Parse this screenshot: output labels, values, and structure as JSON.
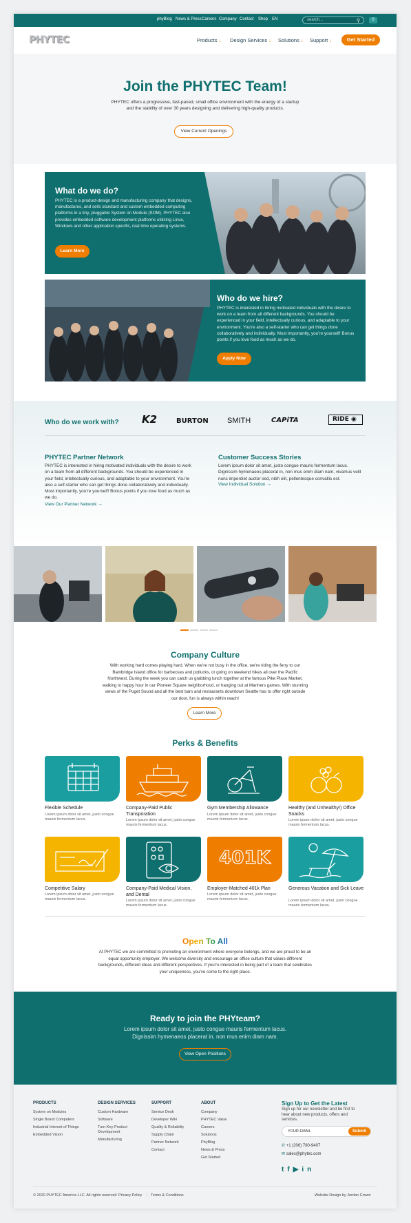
{
  "topnav": {
    "items": [
      "phyBlog",
      "News & Press",
      "Careers",
      "Company",
      "Contact",
      "Shop",
      "EN"
    ],
    "search_placeholder": "search...",
    "cart_count": "0"
  },
  "header": {
    "logo": "PHYTEC",
    "nav": [
      "Products",
      "Design Services",
      "Solutions",
      "Support"
    ],
    "cta": "Get Started"
  },
  "hero": {
    "title": "Join the PHYTEC Team!",
    "text": "PHYTEC offers a progressive, fast-paced, small office environment with the energy of a startup and the stability of over 30 years designing and delivering high-quality products.",
    "button": "View Current Openings"
  },
  "what": {
    "title": "What do we do?",
    "text": "PHYTEC is a product-design and manufacturing company that designs, manufactures, and sells standard and custom embedded computing platforms in a tiny, pluggable System on Module (SOM). PHYTEC also provides embedded software development platforms utilizing Linux, Windows and other application specific, real time operating systems.",
    "button": "Learn More"
  },
  "who": {
    "title": "Who do we hire?",
    "text": "PHYTEC is interested in hiring motivated individuals with the desire to work on a team from all different backgrounds. You should be experienced in your field, intellectually curious, and adaptable to your environment. You’re also a self-starter who can get things done collaboratively and individually. Most importantly, you’re yourself! Bonus points if you love food as much as we do.",
    "button": "Apply Now"
  },
  "work_with": {
    "title": "Who do we work with?",
    "brands": [
      "K2",
      "BURTON",
      "SMITH",
      "CAPiTA",
      "RIDE"
    ]
  },
  "partner": {
    "title": "PHYTEC Partner Network",
    "text": "PHYTEC is interested in hiring motivated individuals with the desire to work on a team from all different backgrounds. You should be experienced in your field, intellectually curious, and adaptable to your environment. You’re also a self-starter who can get things done collaboratively and individually. Most importantly, you’re yourself! Bonus points if you love food as much as we do.",
    "link": "View Our Partner Network"
  },
  "success": {
    "title": "Customer Success Stories",
    "text": "Lorem ipsum dolor sit amet, justo congue mauris fermentum lacus. Dignissim hymenaeos placerat in, non mus enim diam nam, vivamus velit nunc imperdiet auctor sed, nibh elit, pellentesque convallis est.",
    "link": "View Individual Solution"
  },
  "culture": {
    "title": "Company Culture",
    "text": "With working hard comes playing hard. When we’re not busy in the office, we’re riding the ferry to our Bainbridge Island office for barbecues and potlucks, or going on weekend hikes all over the Pacific Northwest. During the week you can catch us grabbing lunch together at the famous Pike Place Market, walking to happy hour in our Pioneer Square neighborhood, or hanging out at Mariners games. With stunning views of the Puget Sound and all the best bars and restaurants downtown Seattle has to offer right outside our door, fun is always within reach!",
    "button": "Learn More"
  },
  "perks": {
    "title": "Perks & Benefits",
    "items": [
      {
        "title": "Flexible Schedule",
        "desc": "Lorem ipsum dolor sit amet, justo congue mauris fermentum lacus.",
        "color": "#1b9ea0",
        "icon": "calendar-icon"
      },
      {
        "title": "Company-Paid Public Transporation",
        "desc": "Lorem ipsum dolor sit amet, justo congue mauris fermentum lacus.",
        "color": "#ef7d00",
        "icon": "ferry-icon"
      },
      {
        "title": "Gym Membership Allowance",
        "desc": "Lorem ipsum dolor sit amet, justo congue mauris fermentum lacus.",
        "color": "#0f6f6e",
        "icon": "exercise-bike-icon"
      },
      {
        "title": "Healthy (and Unhealthy!) Office Snacks",
        "desc": "Lorem ipsum dolor sit amet, justo congue mauris fermentum lacus.",
        "color": "#f5b400",
        "icon": "fruit-icon"
      },
      {
        "title": "Competitive Salary",
        "desc": "Lorem ipsum dolor sit amet, justo congue mauris fermentum lacus.",
        "color": "#f5b400",
        "icon": "check-icon"
      },
      {
        "title": "Company-Paid Medical Vision, and Dental",
        "desc": "Lorem ipsum dolor sit amet, justo congue mauris fermentum lacus.",
        "color": "#0f6f6e",
        "icon": "eye-chart-icon"
      },
      {
        "title": "Employer-Matched 401k Plan",
        "desc": "Lorem ipsum dolor sit amet, justo congue mauris fermentum lacus.",
        "color": "#ef7d00",
        "icon": "401k-icon",
        "badge": "401K"
      },
      {
        "title": "Generous Vacation and Sick Leave",
        "desc": "Lorem ipsum dolor sit amet, justo congue mauris fermentum lacus.",
        "color": "#1b9ea0",
        "icon": "beach-icon"
      }
    ]
  },
  "open": {
    "title": "Open To All",
    "text": "At PHYTEC we are committed to promoting an environment where everyone belongs, and we are proud to be an equal opportunity employer. We welcome diversity and encourage an office culture that values different backgrounds, different ideas and different perspectives. If you’re interested in being part of a team that celebrates your uniqueness, you’ve come to the right place."
  },
  "cta": {
    "title": "Ready to join the PHYteam?",
    "text": "Lorem ipsum dolor sit amet, justo congue mauris fermentum lacus. Dignissim hymenaeos placerat in, non mus enim diam nam.",
    "button": "View Open Positions"
  },
  "footer": {
    "cols": [
      {
        "head": "PRODUCTS",
        "links": [
          "System on Modules",
          "Single Board Computers",
          "Industrial Internet of Things",
          "Embedded Vision"
        ]
      },
      {
        "head": "DESIGN SERVICES",
        "links": [
          "Custom Hardware",
          "Software",
          "Turn-Key Product Development",
          "Manufacturing"
        ]
      },
      {
        "head": "SUPPORT",
        "links": [
          "Service Desk",
          "Developer Wiki",
          "Quality & Reliability",
          "Supply Chain",
          "Partner Network",
          "Contact"
        ]
      },
      {
        "head": "ABOUT",
        "links": [
          "Company",
          "PHYTEC Value",
          "Careers",
          "Solutions",
          "PhyBlog",
          "News & Press",
          "Get Started"
        ]
      }
    ],
    "signup_title": "Sign Up to Get the Latest",
    "signup_text": "Sign up for our newsletter and be first to hear about new products, offers and services.",
    "email_placeholder": "YOUR EMAIL",
    "submit": "Submit",
    "phone": "+1 (206) 780-9407",
    "email": "sales@phytec.com",
    "copyright": "© 2020 PHYTEC America LLC. All rights reserved",
    "privacy": "Privacy Policy",
    "terms": "Terms & Conditions",
    "credit": "Website Design by Jordan Crown"
  }
}
